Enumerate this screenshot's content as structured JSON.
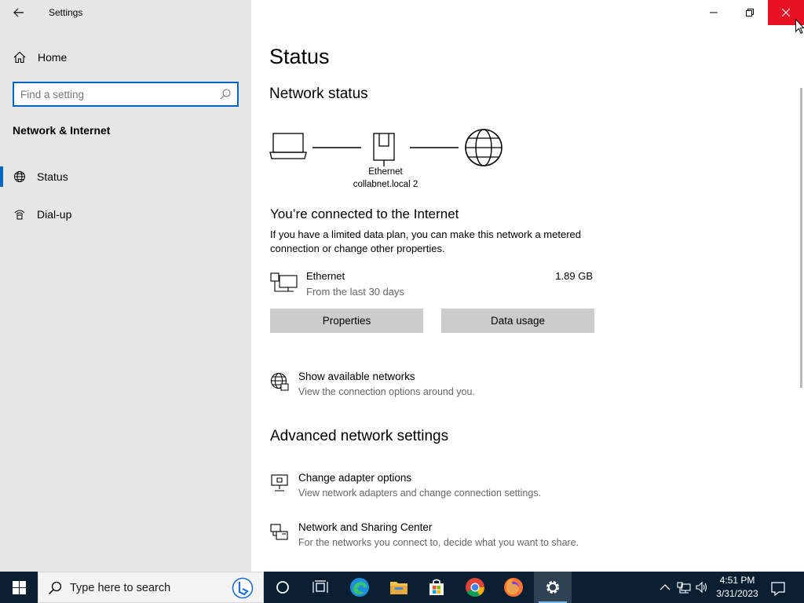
{
  "app": {
    "title": "Settings"
  },
  "sidebar": {
    "home_label": "Home",
    "search_placeholder": "Find a setting",
    "section_title": "Network & Internet",
    "items": [
      {
        "label": "Status",
        "icon": "globe-network-icon",
        "selected": true
      },
      {
        "label": "Dial-up",
        "icon": "dial-up-icon",
        "selected": false
      }
    ]
  },
  "main": {
    "title": "Status",
    "network_status_heading": "Network status",
    "diagram": {
      "adapter_label": "Ethernet",
      "network_label": "collabnet.local 2"
    },
    "connected_title": "You’re connected to the Internet",
    "connected_desc": "If you have a limited data plan, you can make this network a metered connection or change other properties.",
    "connection": {
      "name": "Ethernet",
      "subtitle": "From the last 30 days",
      "usage": "1.89 GB"
    },
    "buttons": {
      "properties": "Properties",
      "data_usage": "Data usage"
    },
    "show_networks": {
      "title": "Show available networks",
      "desc": "View the connection options around you."
    },
    "advanced_heading": "Advanced network settings",
    "links": [
      {
        "title": "Change adapter options",
        "desc": "View network adapters and change connection settings."
      },
      {
        "title": "Network and Sharing Center",
        "desc": "For the networks you connect to, decide what you want to share."
      }
    ]
  },
  "taskbar": {
    "search_text": "Type here to search",
    "time": "4:51 PM",
    "date": "3/31/2023",
    "apps": [
      "cortana-icon",
      "task-view-icon",
      "edge-icon",
      "file-explorer-icon",
      "store-icon",
      "chrome-icon",
      "firefox-icon",
      "settings-gear-icon"
    ]
  },
  "colors": {
    "accent": "#0067c0",
    "close_red": "#e81123",
    "sidebar_bg": "#e6e6e6",
    "taskbar_bg": "#0b1f33"
  }
}
